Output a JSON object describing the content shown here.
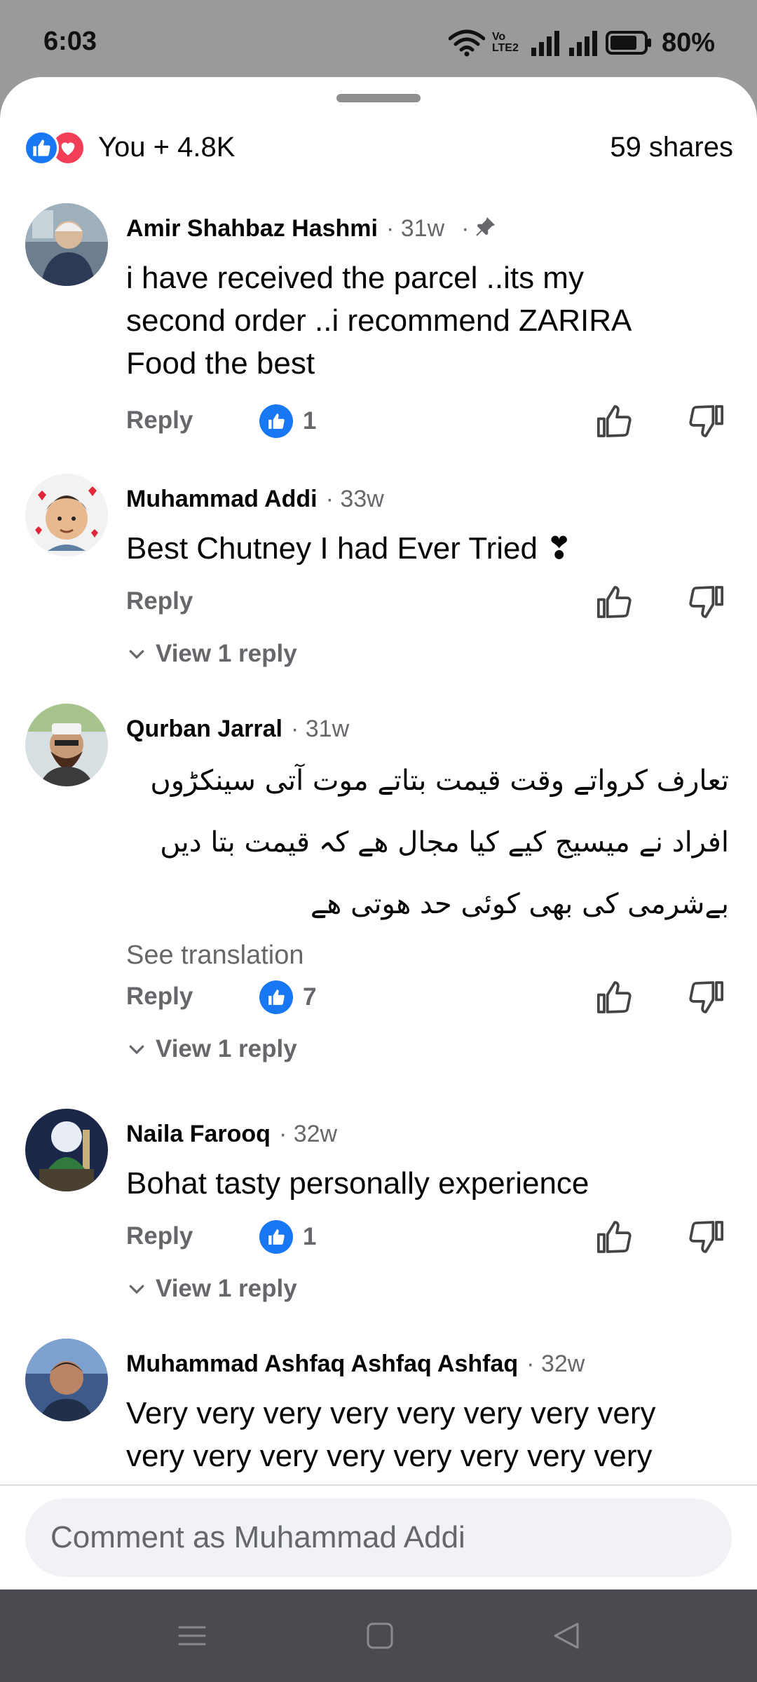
{
  "status_bar": {
    "time": "6:03",
    "network_label": "Vo LTE2",
    "battery_percent": "80%",
    "battery_level": 0.8
  },
  "reactions": {
    "icons": [
      "like-icon",
      "love-icon"
    ],
    "count_text": "You + 4.8K",
    "shares_text": "59 shares"
  },
  "comments": [
    {
      "name": "Amir Shahbaz Hashmi",
      "time": "· 31w",
      "pinned": true,
      "text": "i have received the parcel ..its my second order ..i recommend ZARIRA Food the best",
      "reply_label": "Reply",
      "likes": "1"
    },
    {
      "name": "Muhammad Addi",
      "time": "· 33w",
      "text": "Best Chutney I had Ever Tried ❣",
      "reply_label": "Reply",
      "view_replies": "View 1 reply"
    },
    {
      "name": "Qurban Jarral",
      "time": "· 31w",
      "text": "تعارف کرواتے وقت قیمت بتاتے موت آتی سینکڑوں افراد نے میسیج کیے کیا مجال ھے کہ قیمت بتا دیں بےشرمی کی بھی کوئی حد ھوتی ھے",
      "see_translation": "See translation",
      "reply_label": "Reply",
      "likes": "7",
      "view_replies": "View 1 reply"
    },
    {
      "name": "Naila Farooq",
      "time": "· 32w",
      "text": "Bohat tasty personally experience",
      "reply_label": "Reply",
      "likes": "1",
      "view_replies": "View 1 reply"
    },
    {
      "name": "Muhammad Ashfaq Ashfaq Ashfaq",
      "time": "· 32w",
      "text": "Very very very very very very very very very very very very very very very very"
    }
  ],
  "composer": {
    "placeholder": "Comment as Muhammad Addi"
  },
  "colors": {
    "accent": "#1877f2",
    "love": "#f33e58",
    "secondary_text": "#65676b",
    "nav_bar": "#4a4b50"
  }
}
